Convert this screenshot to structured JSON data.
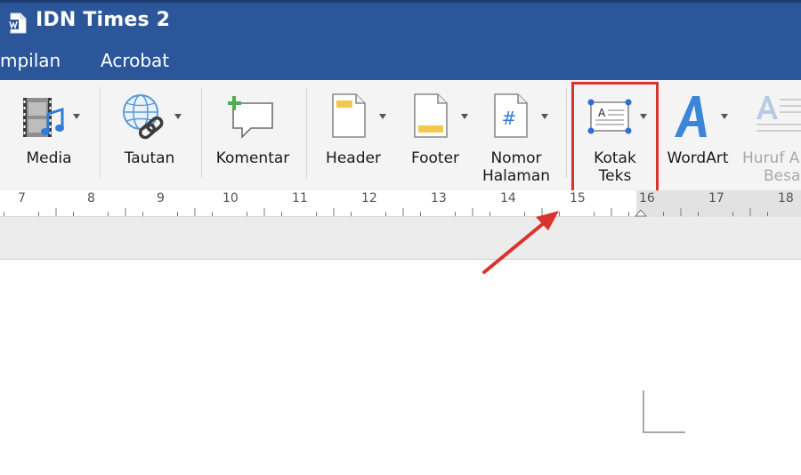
{
  "window": {
    "title": "IDN Times 2"
  },
  "menubar": {
    "items": [
      "mpilan",
      "Acrobat"
    ]
  },
  "ribbon": {
    "media": "Media",
    "tautan": "Tautan",
    "komentar": "Komentar",
    "header": "Header",
    "footer": "Footer",
    "nomor_line1": "Nomor",
    "nomor_line2": "Halaman",
    "kotak_line1": "Kotak",
    "kotak_line2": "Teks",
    "wordart": "WordArt",
    "huruf_line1": "Huruf A",
    "huruf_line2": "Besa",
    "kotak_icon_letter": "A",
    "nomor_icon_glyph": "#"
  },
  "ruler": {
    "numbers": [
      "7",
      "8",
      "9",
      "10",
      "11",
      "12",
      "13",
      "14",
      "15",
      "16",
      "17",
      "18"
    ]
  },
  "colors": {
    "title_bar": "#2b5699",
    "highlight": "#d9342b",
    "ribbon_bg": "#f4f4f4"
  },
  "icons": [
    "word-doc-icon",
    "media-icon",
    "link-icon",
    "comment-icon",
    "header-icon",
    "footer-icon",
    "page-number-icon",
    "text-box-icon",
    "wordart-icon",
    "drop-cap-icon"
  ]
}
